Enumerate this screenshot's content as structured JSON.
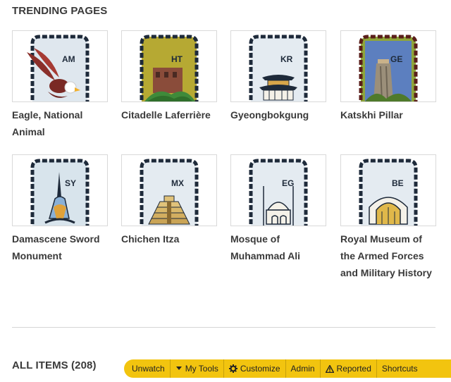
{
  "sections": {
    "trending_title": "TRENDING PAGES",
    "all_items_title": "ALL ITEMS (208)"
  },
  "cards": [
    {
      "caption": "Eagle, National Animal",
      "code": "AM",
      "bg": "#dfe7ee",
      "icon": "eagle-icon"
    },
    {
      "caption": "Citadelle Laferrière",
      "code": "HT",
      "bg": "#b6a933",
      "icon": "citadel-icon"
    },
    {
      "caption": "Gyeongbokgung",
      "code": "KR",
      "bg": "#e4ebf1",
      "icon": "palace-icon"
    },
    {
      "caption": "Katskhi Pillar",
      "code": "GE",
      "bg": "#8fa53a",
      "icon": "pillar-icon"
    },
    {
      "caption": "Damascene Sword Monument",
      "code": "SY",
      "bg": "#d8e4ec",
      "icon": "sword-monument-icon"
    },
    {
      "caption": "Chichen Itza",
      "code": "MX",
      "bg": "#e4ebf1",
      "icon": "pyramid-icon"
    },
    {
      "caption": "Mosque of Muhammad Ali",
      "code": "EG",
      "bg": "#e4ebf1",
      "icon": "mosque-icon"
    },
    {
      "caption": "Royal Museum of the Armed Forces and Military History",
      "code": "BE",
      "bg": "#e4ebf1",
      "icon": "museum-arch-icon"
    }
  ],
  "toolbar": {
    "unwatch": "Unwatch",
    "my_tools": "My Tools",
    "customize": "Customize",
    "admin": "Admin",
    "reported": "Reported",
    "shortcuts": "Shortcuts"
  },
  "colors": {
    "toolbar_bg": "#f2c40f",
    "stamp_border": "#1e2a3a"
  }
}
